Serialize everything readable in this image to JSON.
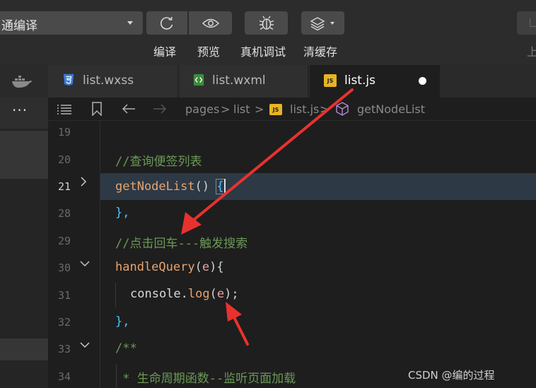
{
  "toolbar": {
    "compile_mode": "通编译",
    "compile_label": "编译",
    "preview_label": "预览",
    "debug_label": "真机调试",
    "cache_label": "清缓存",
    "upload_label": "上"
  },
  "tabs": [
    {
      "label": "list.wxss",
      "icon": "css-file-icon"
    },
    {
      "label": "list.wxml",
      "icon": "wxml-file-icon"
    },
    {
      "label": "list.js",
      "icon": "js-file-icon",
      "active": true,
      "unsaved": true
    }
  ],
  "breadcrumb": {
    "pages": "pages",
    "list": "list",
    "file": "list.js",
    "function": "getNodeList",
    "sep": ">",
    "js_badge": "JS"
  },
  "sidebar": {
    "more": "···"
  },
  "editor": {
    "lines": [
      {
        "num": "19"
      },
      {
        "num": "20",
        "text": "//查询便签列表"
      },
      {
        "num": "21",
        "active": true,
        "folded": true,
        "text_fn": "getNodeList",
        "text_rest": "() ",
        "brace": "{"
      },
      {
        "num": "28",
        "text": "},"
      },
      {
        "num": "29",
        "text": "//点击回车---触发搜索"
      },
      {
        "num": "30",
        "fold_open": true,
        "text_fn": "handleQuery",
        "text_paren_open": "(",
        "text_param": "e",
        "text_paren_close": "){"
      },
      {
        "num": "31",
        "text_obj": "console.",
        "text_call": "log",
        "text_open": "(",
        "text_param": "e",
        "text_close": ");"
      },
      {
        "num": "32",
        "text": "},"
      },
      {
        "num": "33",
        "fold_open": true,
        "text": "/**"
      },
      {
        "num": "34",
        "text": " * 生命周期函数--监听页面加载"
      }
    ]
  },
  "watermark": "CSDN @编的过程",
  "colors": {
    "annotation_arrow": "#e8322e",
    "comment": "#6a9955",
    "function": "#e8a36d",
    "brace": "#4fc1ff",
    "current_line": "#2d3945"
  }
}
